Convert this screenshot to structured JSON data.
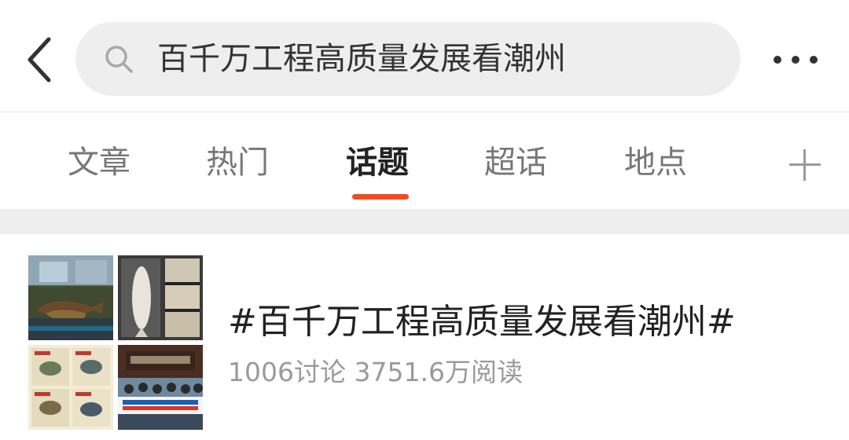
{
  "search": {
    "query": "百千万工程高质量发展看潮州"
  },
  "tabs": [
    {
      "label": "文章"
    },
    {
      "label": "热门"
    },
    {
      "label": "话题",
      "active": true
    },
    {
      "label": "超话"
    },
    {
      "label": "地点"
    }
  ],
  "icons": {
    "back": "back-arrow-icon",
    "search": "search-icon",
    "more": "more-dots-icon",
    "add": "plus-icon"
  },
  "colors": {
    "accent": "#f04b22",
    "search_bg": "#eeeeee",
    "tab_active": "#222222",
    "tab_inactive": "#777777",
    "meta_text": "#9a9a9a"
  },
  "result": {
    "title": "#百千万工程高质量发展看潮州#",
    "meta": "1006讨论 3751.6万阅读"
  }
}
